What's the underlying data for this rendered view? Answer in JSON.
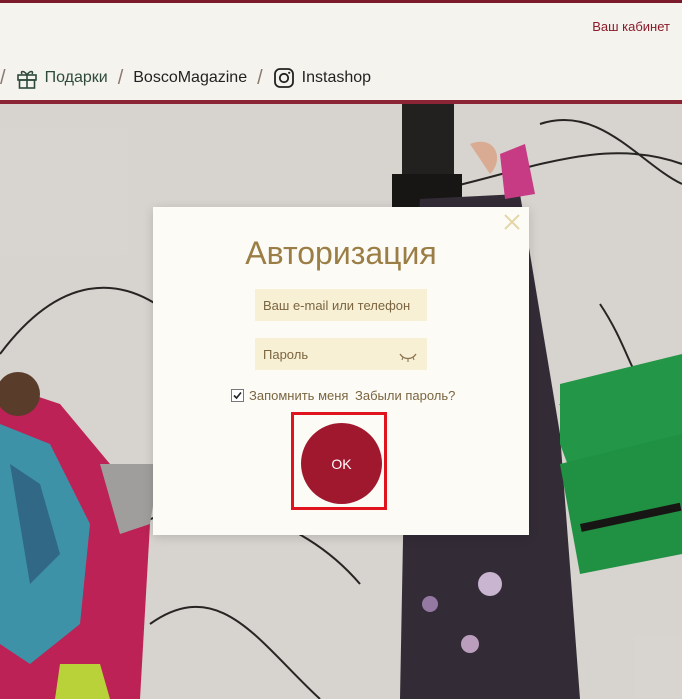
{
  "header": {
    "cabinet_label": "Ваш кабинет",
    "nav": [
      {
        "label": "Подарки",
        "icon": "gift-icon"
      },
      {
        "label": "BoscoMagazine"
      },
      {
        "label": "Instashop",
        "icon": "instagram-icon"
      }
    ]
  },
  "modal": {
    "title": "Авторизация",
    "email_placeholder": "Ваш e-mail или телефон",
    "password_placeholder": "Пароль",
    "remember_label": "Запомнить меня",
    "remember_checked": true,
    "forgot_label": "Забыли пароль?",
    "ok_label": "OK",
    "close_icon": "close-icon",
    "eye_icon": "eye-closed-icon"
  },
  "colors": {
    "brand": "#8b1a2a",
    "button": "#a0182e",
    "title": "#9b7e45",
    "field_bg": "#f8f0d4",
    "highlight": "#e0141e"
  }
}
